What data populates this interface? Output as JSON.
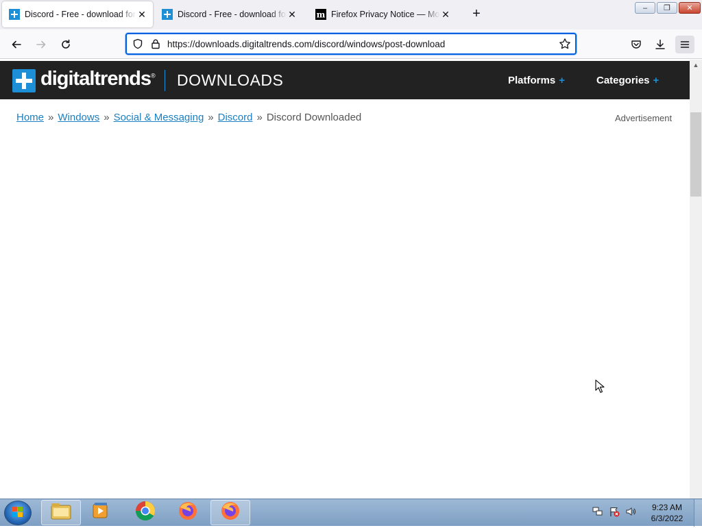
{
  "browser": {
    "tabs": [
      {
        "title": "Discord - Free - download for Windows",
        "favicon": "digitaltrends-plus-icon",
        "active": true
      },
      {
        "title": "Discord - Free - download for Windows",
        "favicon": "digitaltrends-plus-icon",
        "active": false
      },
      {
        "title": "Firefox Privacy Notice — Mozilla",
        "favicon": "mozilla-m-icon",
        "active": false
      }
    ],
    "url_prefix": "https://downloads.",
    "url_domain": "digitaltrends.com",
    "url_path": "/discord/windows/post-download",
    "window_controls": {
      "minimize": "–",
      "restore": "❐",
      "close": "✕"
    }
  },
  "site": {
    "logo_text": "digitaltrends",
    "logo_registered": "®",
    "section": "DOWNLOADS",
    "nav": [
      {
        "label": "Platforms",
        "plus": "+"
      },
      {
        "label": "Categories",
        "plus": "+"
      }
    ],
    "accent_color": "#1c8fd6"
  },
  "breadcrumb": {
    "items": [
      "Home",
      "Windows",
      "Social & Messaging",
      "Discord"
    ],
    "separator": "»",
    "current": "Discord Downloaded"
  },
  "advertisement_label": "Advertisement",
  "taskbar": {
    "items": [
      "windows-explorer-icon",
      "media-player-icon",
      "chrome-icon",
      "firefox-icon",
      "firefox-active-icon"
    ],
    "clock_time": "9:23 AM",
    "clock_date": "6/3/2022"
  }
}
